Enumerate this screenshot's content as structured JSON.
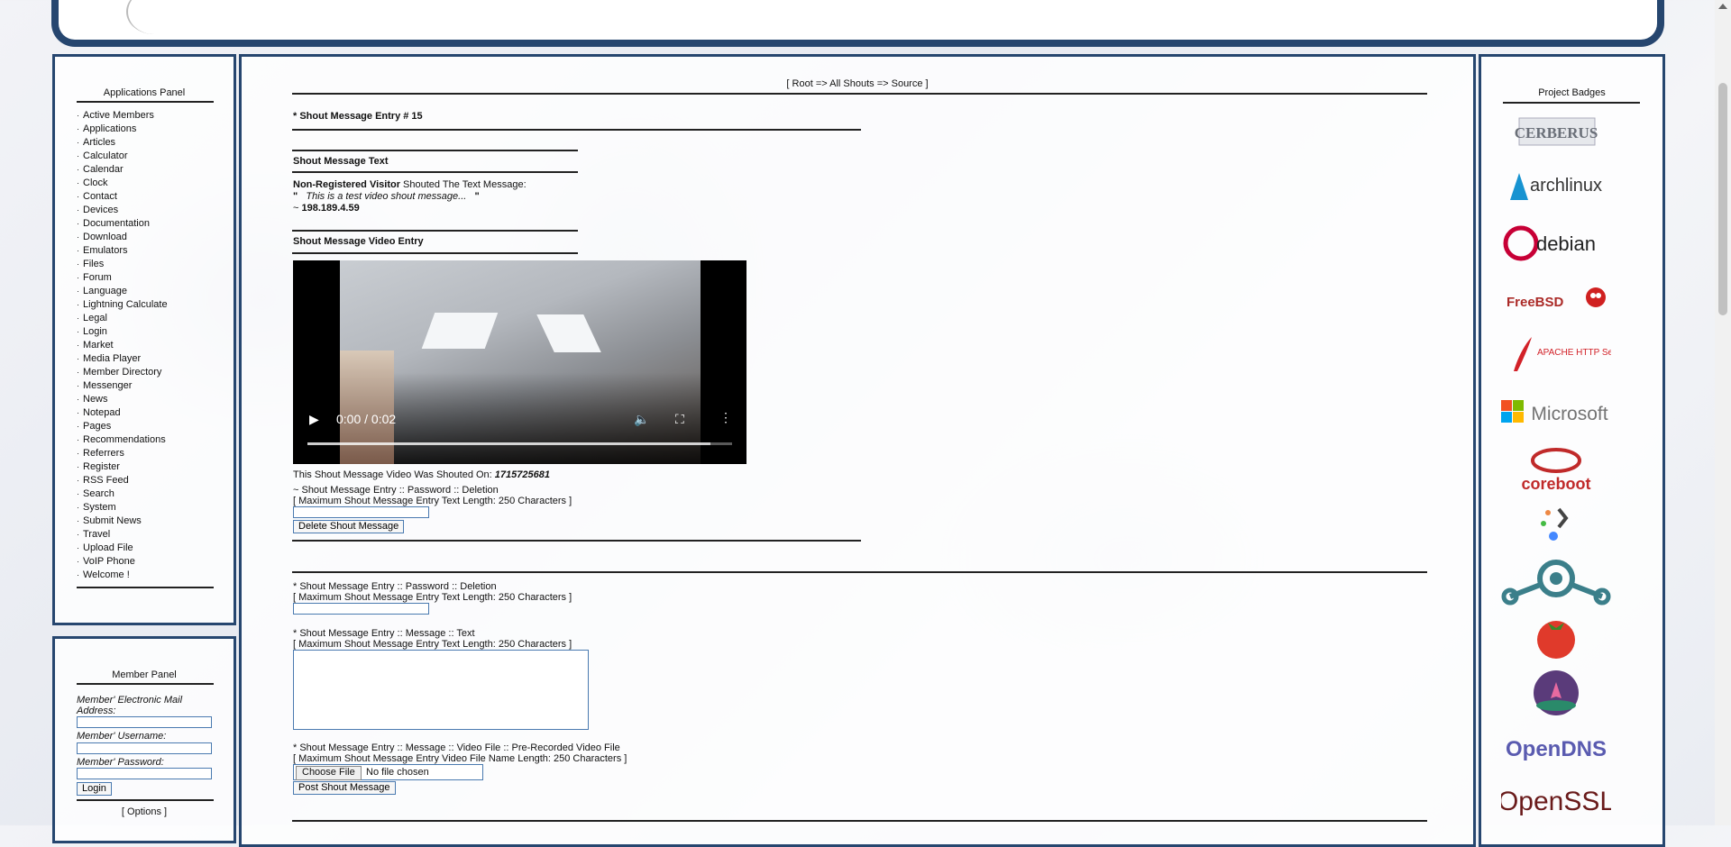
{
  "app_panel": {
    "title": "Applications Panel",
    "items": [
      "Active Members",
      "Applications",
      "Articles",
      "Calculator",
      "Calendar",
      "Clock",
      "Contact",
      "Devices",
      "Documentation",
      "Download",
      "Emulators",
      "Files",
      "Forum",
      "Language",
      "Lightning Calculate",
      "Legal",
      "Login",
      "Market",
      "Media Player",
      "Member Directory",
      "Messenger",
      "News",
      "Notepad",
      "Pages",
      "Recommendations",
      "Referrers",
      "Register",
      "RSS Feed",
      "Search",
      "System",
      "Submit News",
      "Travel",
      "Upload File",
      "VoIP Phone",
      "Welcome !"
    ]
  },
  "member_panel": {
    "title": "Member Panel",
    "email_label": "Member' Electronic Mail Address:",
    "username_label": "Member' Username:",
    "password_label": "Member' Password:",
    "login_button": "Login",
    "options_link": "[ Options ]"
  },
  "main": {
    "breadcrumb": "[ Root => All Shouts => Source ]",
    "entry_title": "* Shout Message Entry # 15",
    "text_heading": "Shout Message Text",
    "visitor": "Non-Registered Visitor",
    "shouted": " Shouted The Text Message:",
    "quote_open": "\"",
    "quote_text": "This is a test video shout message...",
    "quote_close": "\"",
    "ip_prefix": "~ ",
    "ip": "198.189.4.59",
    "video_heading": "Shout Message Video Entry",
    "video_time": "0:00 / 0:02",
    "video_progress": 0.95,
    "shouted_on": "This Shout Message Video Was Shouted On: ",
    "shouted_on_value": "1715725681",
    "password_deletion": "~ Shout Message Entry :: Password :: Deletion",
    "max_len": "[ Maximum Shout Message Entry Text Length: 250 Characters ]",
    "delete_button": "Delete Shout Message",
    "form_password": "* Shout Message Entry :: Password :: Deletion",
    "form_password_max": "[ Maximum Shout Message Entry Text Length: 250 Characters ]",
    "form_text": "* Shout Message Entry :: Message :: Text",
    "form_text_max": "[ Maximum Shout Message Entry Text Length: 250 Characters ]",
    "form_video": "* Shout Message Entry :: Message :: Video File :: Pre-Recorded Video File",
    "form_video_max": "[ Maximum Shout Message Entry Video File Name Length: 250 Characters ]",
    "choose_file": "Choose File",
    "no_file": "No file chosen",
    "post_button": "Post Shout Message"
  },
  "badges": {
    "title": "Project Badges",
    "items": [
      "CERBERUS",
      "archlinux",
      "debian",
      "FreeBSD",
      "APACHE HTTP Server",
      "Microsoft",
      "coreboot",
      "",
      "",
      "",
      "",
      "OpenDNS",
      "OpenSSL"
    ]
  },
  "colors": {
    "frame": "#26466f",
    "input_border": "#4a7ab0",
    "required": "#cc0000"
  }
}
